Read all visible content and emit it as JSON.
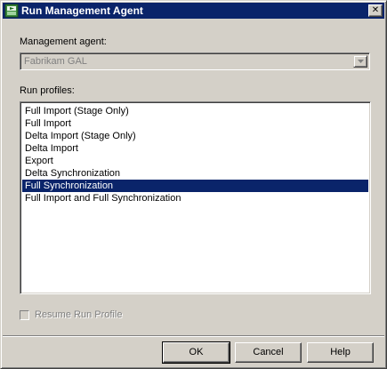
{
  "window": {
    "title": "Run Management Agent",
    "close_glyph": "✕"
  },
  "management_agent": {
    "label": "Management agent:",
    "value": "Fabrikam GAL"
  },
  "run_profiles": {
    "label": "Run profiles:",
    "items": [
      "Full Import (Stage Only)",
      "Full Import",
      "Delta Import (Stage Only)",
      "Delta Import",
      "Export",
      "Delta Synchronization",
      "Full Synchronization",
      "Full Import and Full Synchronization"
    ],
    "selected": "Full Synchronization"
  },
  "resume": {
    "label": "Resume Run Profile",
    "checked": false,
    "enabled": false
  },
  "buttons": {
    "ok": "OK",
    "cancel": "Cancel",
    "help": "Help"
  },
  "colors": {
    "titlebar": "#0a246a",
    "selection": "#0a246a",
    "dialog_bg": "#d4d0c8"
  }
}
